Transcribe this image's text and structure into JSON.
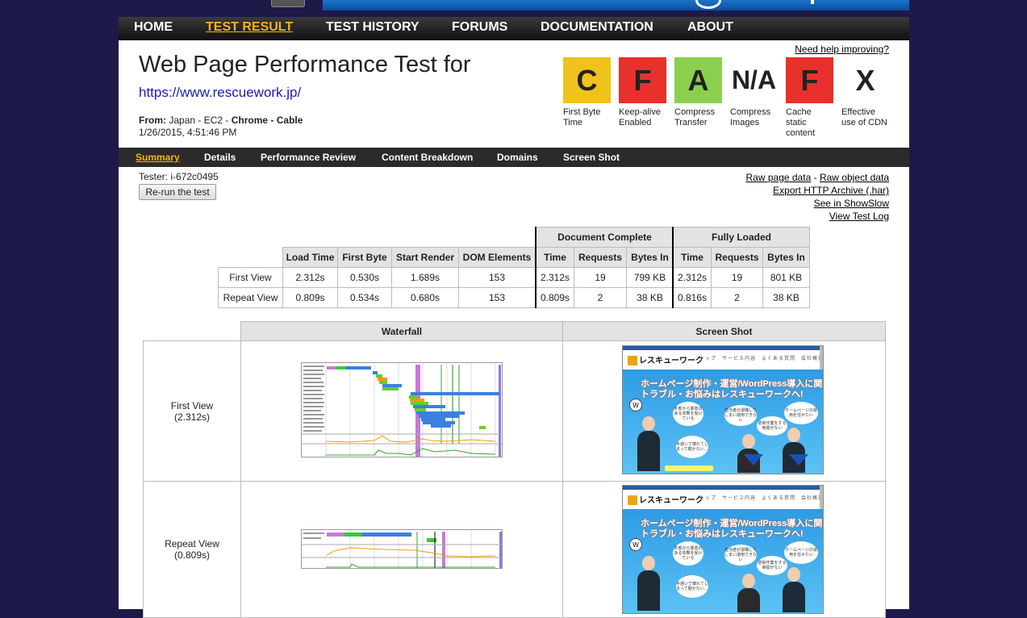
{
  "nav": {
    "items": [
      "HOME",
      "TEST RESULT",
      "TEST HISTORY",
      "FORUMS",
      "DOCUMENTATION",
      "ABOUT"
    ],
    "active": "TEST RESULT"
  },
  "header": {
    "title": "Web Page Performance Test for",
    "url": "https://www.rescuework.jp/",
    "from_label": "From:",
    "from_location": "Japan - EC2 -",
    "browser": "Chrome",
    "sep": "-",
    "connection": "Cable",
    "date": "1/26/2015, 4:51:46 PM",
    "help_link": "Need help improving?"
  },
  "grades": [
    {
      "grade": "C",
      "label": "First Byte Time",
      "color": "#f0c31c"
    },
    {
      "grade": "F",
      "label": "Keep-alive Enabled",
      "color": "#e8302c"
    },
    {
      "grade": "A",
      "label": "Compress Transfer",
      "color": "#8ccf4d"
    },
    {
      "grade": "N/A",
      "label": "Compress Images",
      "color": "#ffffff"
    },
    {
      "grade": "F",
      "label": "Cache static content",
      "color": "#e8302c"
    },
    {
      "grade": "X",
      "label": "Effective use of CDN",
      "color": "#ffffff"
    }
  ],
  "subnav": {
    "items": [
      "Summary",
      "Details",
      "Performance Review",
      "Content Breakdown",
      "Domains",
      "Screen Shot"
    ],
    "active": "Summary"
  },
  "tester": "Tester: i-672c0495",
  "rerun_label": "Re-run the test",
  "links": {
    "raw_page": "Raw page data",
    "dash": "-",
    "raw_object": "Raw object data",
    "export_har": "Export HTTP Archive (.har)",
    "showslow": "See in ShowSlow",
    "test_log": "View Test Log"
  },
  "results": {
    "group_headers": [
      "Document Complete",
      "Fully Loaded"
    ],
    "columns": [
      "Load Time",
      "First Byte",
      "Start Render",
      "DOM Elements",
      "Time",
      "Requests",
      "Bytes In",
      "Time",
      "Requests",
      "Bytes In"
    ],
    "rows": [
      {
        "label": "First View",
        "cells": [
          "2.312s",
          "0.530s",
          "1.689s",
          "153",
          "2.312s",
          "19",
          "799 KB",
          "2.312s",
          "19",
          "801 KB"
        ]
      },
      {
        "label": "Repeat View",
        "cells": [
          "0.809s",
          "0.534s",
          "0.680s",
          "153",
          "0.809s",
          "2",
          "38 KB",
          "0.816s",
          "2",
          "38 KB"
        ]
      }
    ]
  },
  "visuals": {
    "headers": [
      "Waterfall",
      "Screen Shot"
    ],
    "rows": [
      {
        "label": "First View",
        "sub": "(2.312s)"
      },
      {
        "label": "Repeat View",
        "sub": "(0.809s)"
      }
    ]
  },
  "screenshot_site": {
    "brand": "レスキューワーク",
    "menu": "トップ　サービス内容　よくある質問　会社概要　お問い合わせ",
    "headline1": "ホームページ制作・運営/WordPress導入に関する",
    "headline2": "トラブル・お悩みはレスキューワークへ!",
    "bubble1": "外部から悪意のある攻撃を受けている",
    "bubble2": "手遅いで壊れてしまって動かない…",
    "bubble3": "担当者が退職してしまい運用できない",
    "bubble4": "更新作業をする時間がない",
    "bubble5": "ホームページの運用を任せたい"
  }
}
